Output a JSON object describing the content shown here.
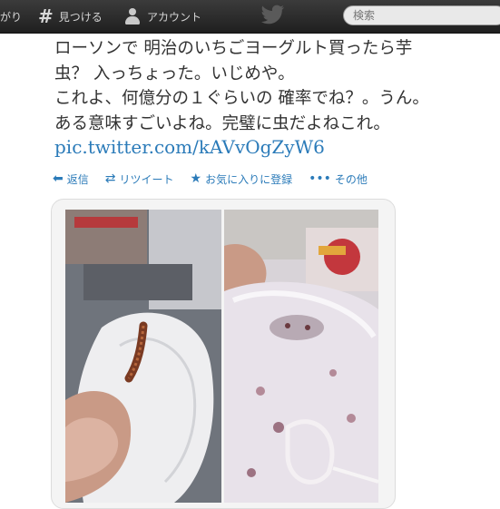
{
  "topbar": {
    "cut_label": "がり",
    "discover_label": "見つける",
    "account_label": "アカウント",
    "search_placeholder": "検索"
  },
  "tweet": {
    "lines": [
      "ローソンで 明治のいちごヨーグルト買ったら芋",
      "虫？ 入っちょった。いじめや。",
      "これよ、何億分の１ぐらいの 確率でね？。うん。",
      "ある意味すごいよね。完璧に虫だよねこれ。"
    ],
    "link": "pic.twitter.com/kAVvOgZyW6"
  },
  "actions": {
    "reply": "返信",
    "retweet": "リツイート",
    "favorite": "お気に入りに登録",
    "more": "その他"
  },
  "colors": {
    "topbar": "#2a2a2a",
    "link": "#2b7bb9",
    "text": "#333333"
  },
  "icons": {
    "discover": "hash-icon",
    "account": "person-icon",
    "brand": "bird-icon",
    "reply": "reply-arrow-icon",
    "retweet": "retweet-icon",
    "favorite": "star-icon",
    "more": "ellipsis-icon"
  }
}
